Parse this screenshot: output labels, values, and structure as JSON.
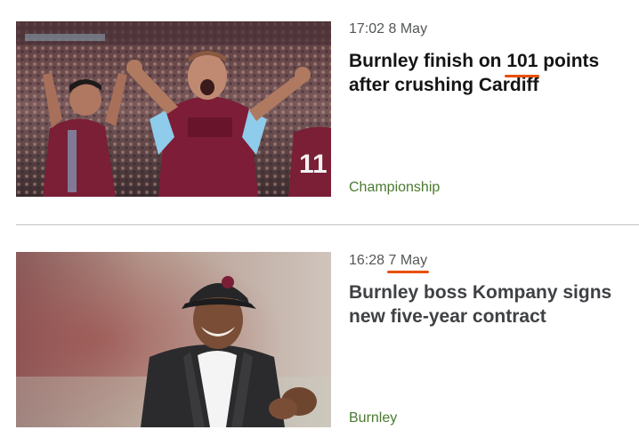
{
  "articles": [
    {
      "time": "17:02",
      "date": "8 May",
      "headline_pre": "Burnley finish on ",
      "headline_highlight": "101",
      "headline_post": " points after crushing Cardiff",
      "tag": "Championship",
      "image_icon": "celebrating-players-photo"
    },
    {
      "time": "16:28",
      "date_highlight": "7 May",
      "headline": "Burnley boss Kompany signs new five-year contract",
      "tag": "Burnley",
      "image_icon": "manager-portrait-photo"
    }
  ],
  "colors": {
    "highlight_underline": "#e8500a",
    "tag_green": "#4a7a2f",
    "divider": "#c5c5c5"
  }
}
